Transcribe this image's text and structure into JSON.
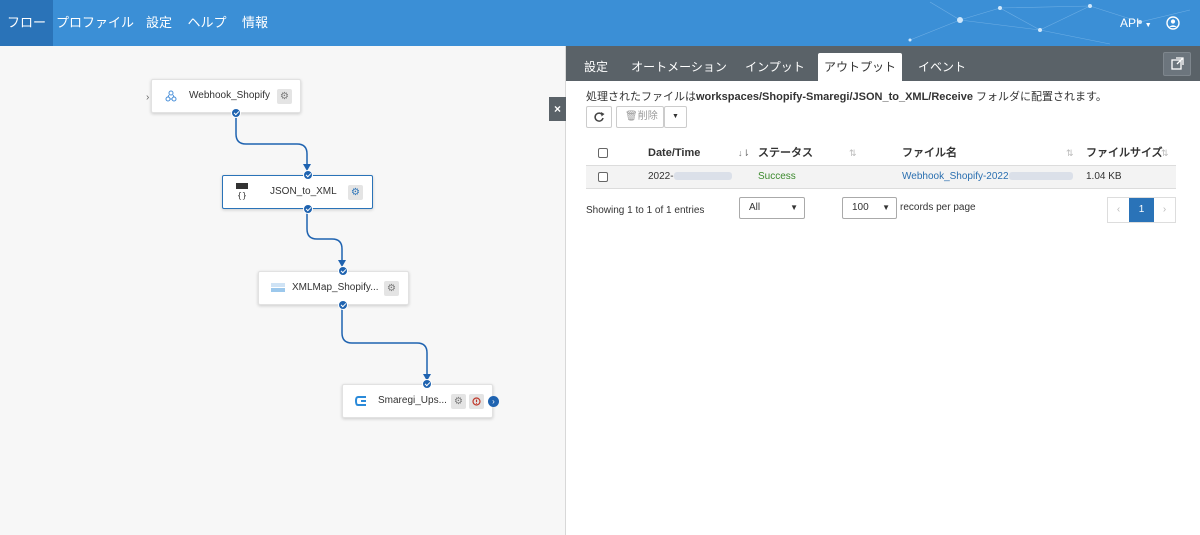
{
  "nav": {
    "items": [
      "フロー",
      "プロファイル",
      "設定",
      "ヘルプ",
      "情報"
    ],
    "api_label": "API"
  },
  "flow": {
    "nodes": [
      {
        "label": "Webhook_Shopify"
      },
      {
        "label": "JSON_to_XML"
      },
      {
        "label": "XMLMap_Shopify..."
      },
      {
        "label": "Smaregi_Ups..."
      }
    ],
    "close_label": "×"
  },
  "panel": {
    "tabs": [
      "設定",
      "オートメーション",
      "インプット",
      "アウトプット",
      "イベント"
    ],
    "active_tab": "アウトプット",
    "info_prefix": "処理されたファイルは",
    "info_path": "workspaces/Shopify-Smaregi/JSON_to_XML/Receive",
    "info_suffix": " フォルダに配置されます。",
    "delete_label": "削除",
    "table": {
      "columns": [
        "Date/Time",
        "ステータス",
        "ファイル名",
        "ファイルサイズ"
      ],
      "rows": [
        {
          "datetime": "2022-",
          "status": "Success",
          "filename": "Webhook_Shopify-2022",
          "size": "1.04 KB"
        }
      ]
    },
    "showing": "Showing 1 to 1 of 1 entries",
    "filter_value": "All",
    "per_page_value": "100",
    "per_page_label": "records per page",
    "pager": {
      "prev": "‹",
      "page": "1",
      "next": "›"
    }
  },
  "colors": {
    "nav_bg": "#3b8fd6",
    "accent": "#2a73b8",
    "success": "#3c8a2e"
  }
}
